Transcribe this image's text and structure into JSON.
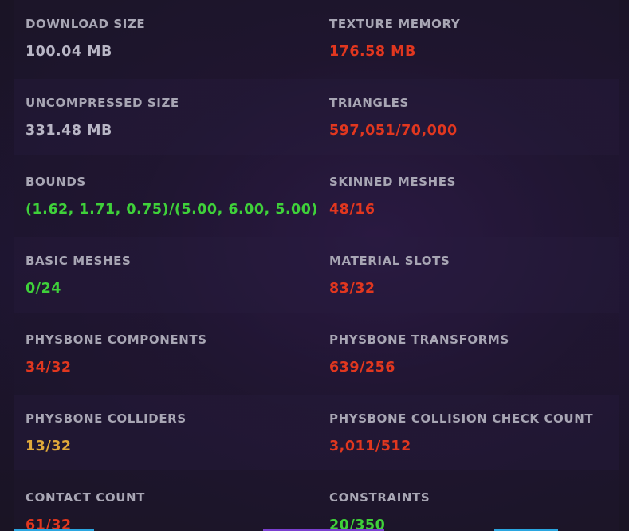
{
  "colors": {
    "neutral": "#b9b7c6",
    "good": "#3fd13a",
    "warning": "#e0a93a",
    "bad": "#e1371f",
    "tab_left": "#2aa6e0",
    "tab_mid": "#7a3fd0",
    "tab_right": "#2aa6e0"
  },
  "stats": [
    {
      "label": "DOWNLOAD SIZE",
      "value": "100.04 MB",
      "status": "neutral"
    },
    {
      "label": "TEXTURE MEMORY",
      "value": "176.58 MB",
      "status": "bad"
    },
    {
      "label": "UNCOMPRESSED SIZE",
      "value": "331.48 MB",
      "status": "neutral"
    },
    {
      "label": "TRIANGLES",
      "value": "597,051/70,000",
      "status": "bad"
    },
    {
      "label": "BOUNDS",
      "value": "(1.62, 1.71, 0.75)/(5.00, 6.00, 5.00)",
      "status": "good"
    },
    {
      "label": "SKINNED MESHES",
      "value": "48/16",
      "status": "bad"
    },
    {
      "label": "BASIC MESHES",
      "value": "0/24",
      "status": "good"
    },
    {
      "label": "MATERIAL SLOTS",
      "value": "83/32",
      "status": "bad"
    },
    {
      "label": "PHYSBONE COMPONENTS",
      "value": "34/32",
      "status": "bad"
    },
    {
      "label": "PHYSBONE TRANSFORMS",
      "value": "639/256",
      "status": "bad"
    },
    {
      "label": "PHYSBONE COLLIDERS",
      "value": "13/32",
      "status": "warning"
    },
    {
      "label": "PHYSBONE COLLISION CHECK COUNT",
      "value": "3,011/512",
      "status": "bad"
    },
    {
      "label": "CONTACT COUNT",
      "value": "61/32",
      "status": "bad"
    },
    {
      "label": "CONSTRAINTS",
      "value": "20/350",
      "status": "good"
    }
  ]
}
